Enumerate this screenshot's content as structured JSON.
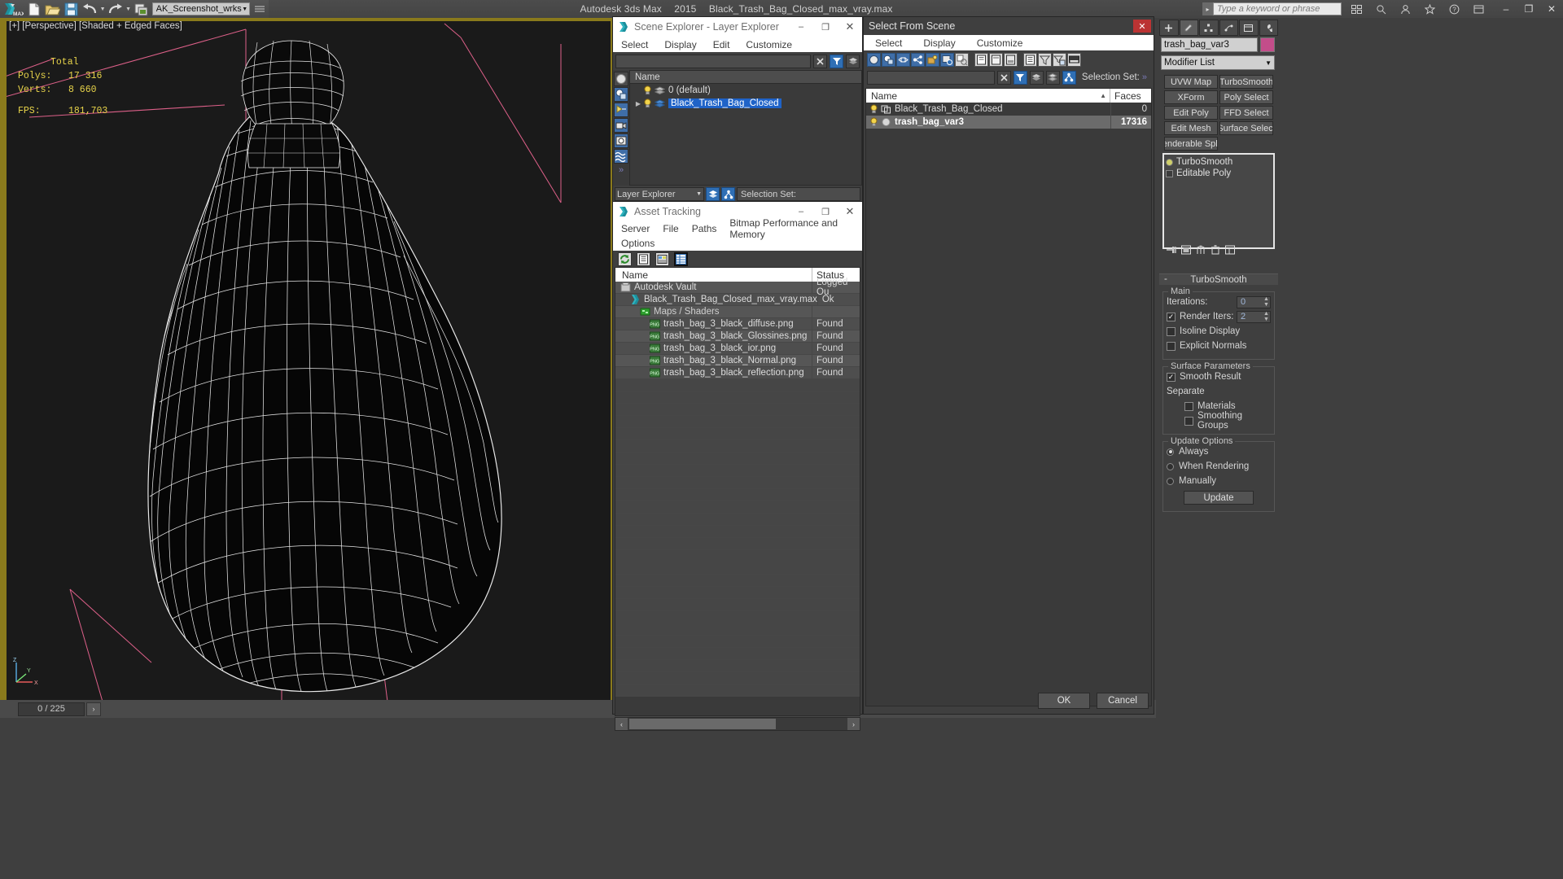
{
  "titlebar": {
    "app": "Autodesk 3ds Max",
    "version": "2015",
    "file": "Black_Trash_Bag_Closed_max_vray.max",
    "minimize": "–",
    "maximize": "❐",
    "close": "✕",
    "search_placeholder": "Type a keyword or phrase"
  },
  "quick_access": {
    "workspace": "AK_Screenshot_wrksp",
    "items": [
      "new-file-icon",
      "open-file-icon",
      "save-file-icon",
      "undo-icon",
      "redo-icon",
      "project-folder-icon"
    ]
  },
  "viewport": {
    "label": "[+] [Perspective] [Shaded + Edged Faces]",
    "stats": {
      "total_label": "Total",
      "polys_label": "Polys:",
      "polys_value": "17 316",
      "verts_label": "Verts:",
      "verts_value": "8 660",
      "fps_label": "FPS:",
      "fps_value": "181,703"
    },
    "axis": {
      "z": "Z",
      "y": "Y",
      "x": "X"
    }
  },
  "statusbar": {
    "frame_field": "0 / 225",
    "next_frame": "›"
  },
  "scene_explorer": {
    "title": "Scene Explorer - Layer Explorer",
    "minimize": "–",
    "maximize": "❐",
    "close": "✕",
    "menus": [
      "Select",
      "Display",
      "Edit",
      "Customize"
    ],
    "column_header": "Name",
    "rows": [
      {
        "name": "0 (default)",
        "selected": false,
        "expandable": false
      },
      {
        "name": "Black_Trash_Bag_Closed",
        "selected": true,
        "expandable": true
      }
    ],
    "mode_combo": "Layer Explorer",
    "selection_set_label": "Selection Set:",
    "more_glyph": "»"
  },
  "asset_tracking": {
    "title": "Asset Tracking",
    "minimize": "–",
    "maximize": "❐",
    "close": "✕",
    "menus_row1": [
      "Server",
      "File",
      "Paths",
      "Bitmap Performance and Memory"
    ],
    "menus_row2": [
      "Options"
    ],
    "columns": {
      "name": "Name",
      "status": "Status"
    },
    "rows": [
      {
        "name": "Autodesk Vault",
        "status": "Logged Ou",
        "icon": "vault-icon",
        "indent": 0
      },
      {
        "name": "Black_Trash_Bag_Closed_max_vray.max",
        "status": "Ok",
        "icon": "max-file-icon",
        "indent": 1
      },
      {
        "name": "Maps / Shaders",
        "status": "",
        "icon": "maps-icon",
        "indent": 2
      },
      {
        "name": "trash_bag_3_black_diffuse.png",
        "status": "Found",
        "icon": "png-icon",
        "indent": 3
      },
      {
        "name": "trash_bag_3_black_Glossines.png",
        "status": "Found",
        "icon": "png-icon",
        "indent": 3
      },
      {
        "name": "trash_bag_3_black_ior.png",
        "status": "Found",
        "icon": "png-icon",
        "indent": 3
      },
      {
        "name": "trash_bag_3_black_Normal.png",
        "status": "Found",
        "icon": "png-icon",
        "indent": 3
      },
      {
        "name": "trash_bag_3_black_reflection.png",
        "status": "Found",
        "icon": "png-icon",
        "indent": 3
      }
    ],
    "empty_rows": 26,
    "scroll_left": "‹",
    "scroll_right": "›"
  },
  "select_from_scene": {
    "title": "Select From Scene",
    "close": "✕",
    "menus": [
      "Select",
      "Display",
      "Customize"
    ],
    "selection_set_label": "Selection Set:",
    "more_glyph": "»",
    "columns": {
      "name": "Name",
      "faces": "Faces",
      "sort_glyph": "▲"
    },
    "rows": [
      {
        "name": "Black_Trash_Bag_Closed",
        "faces": "0",
        "selected": false,
        "icon": "group-icon"
      },
      {
        "name": "trash_bag_var3",
        "faces": "17316",
        "selected": true,
        "icon": "mesh-icon"
      }
    ],
    "ok_label": "OK",
    "cancel_label": "Cancel"
  },
  "command_panel": {
    "object_name": "trash_bag_var3",
    "object_color": "#c34d8a",
    "modifier_list_label": "Modifier List",
    "modifier_buttons": [
      "UVW Map",
      "TurboSmooth",
      "XForm",
      "Poly Select",
      "Edit Poly",
      "FFD Select",
      "Edit Mesh",
      "Surface Select",
      "enderable Spli",
      ""
    ],
    "stack": [
      {
        "label": "TurboSmooth",
        "type": "modifier"
      },
      {
        "label": "Editable Poly",
        "type": "base"
      }
    ],
    "rollout_title": "TurboSmooth",
    "rollout_minus": "-",
    "groups": {
      "main": {
        "caption": "Main",
        "iterations_label": "Iterations:",
        "iterations_value": "0",
        "render_iters_label": "Render Iters:",
        "render_iters_value": "2",
        "render_iters_checked": true,
        "isoline_label": "Isoline Display",
        "isoline_checked": false,
        "explicit_label": "Explicit Normals",
        "explicit_checked": false
      },
      "surface": {
        "caption": "Surface Parameters",
        "smooth_label": "Smooth Result",
        "smooth_checked": true,
        "separate_label": "Separate",
        "materials_label": "Materials",
        "materials_checked": false,
        "smoothing_groups_label": "Smoothing Groups",
        "smoothing_groups_checked": false
      },
      "update": {
        "caption": "Update Options",
        "options": [
          {
            "label": "Always",
            "selected": true
          },
          {
            "label": "When Rendering",
            "selected": false
          },
          {
            "label": "Manually",
            "selected": false
          }
        ],
        "update_button": "Update"
      }
    }
  }
}
